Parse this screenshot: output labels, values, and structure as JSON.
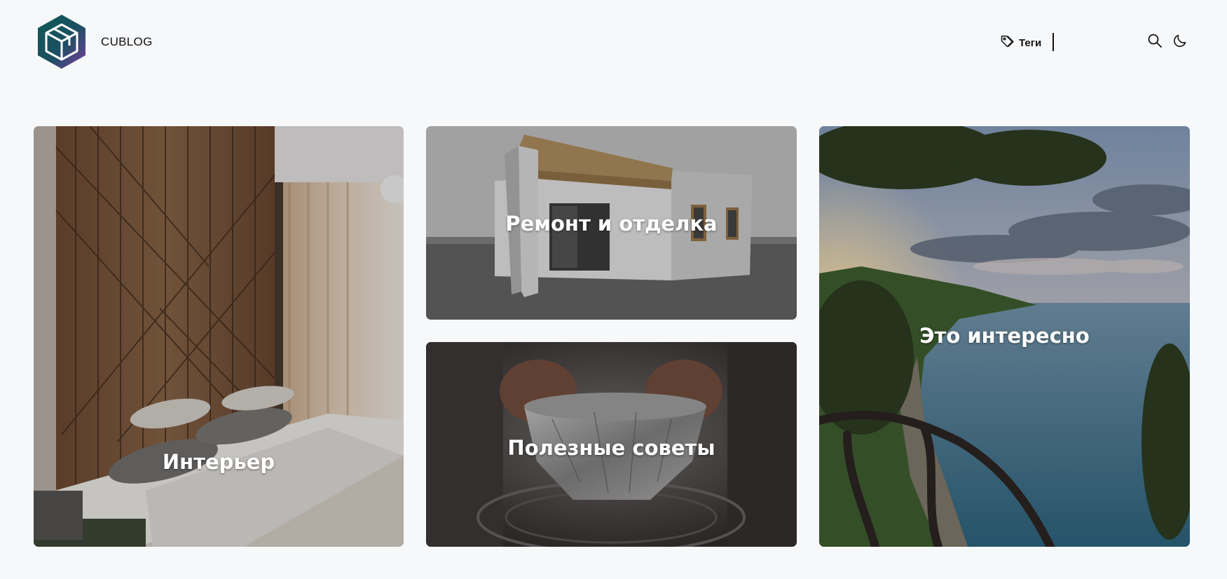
{
  "header": {
    "brand": "CUBLOG",
    "nav": {
      "tags_label": "Теги",
      "tags_icon": "tag-icon"
    },
    "search_icon": "search-icon",
    "theme_icon": "moon-icon"
  },
  "colors": {
    "background": "#f7f8fa",
    "logo_teal": "#17545a",
    "logo_purple": "#7a3fa0",
    "tile_text": "#ffffff"
  },
  "categories": [
    {
      "title": "Интерьер"
    },
    {
      "title": "Ремонт и отделка"
    },
    {
      "title": "Полезные советы"
    },
    {
      "title": "Это интересно"
    }
  ]
}
